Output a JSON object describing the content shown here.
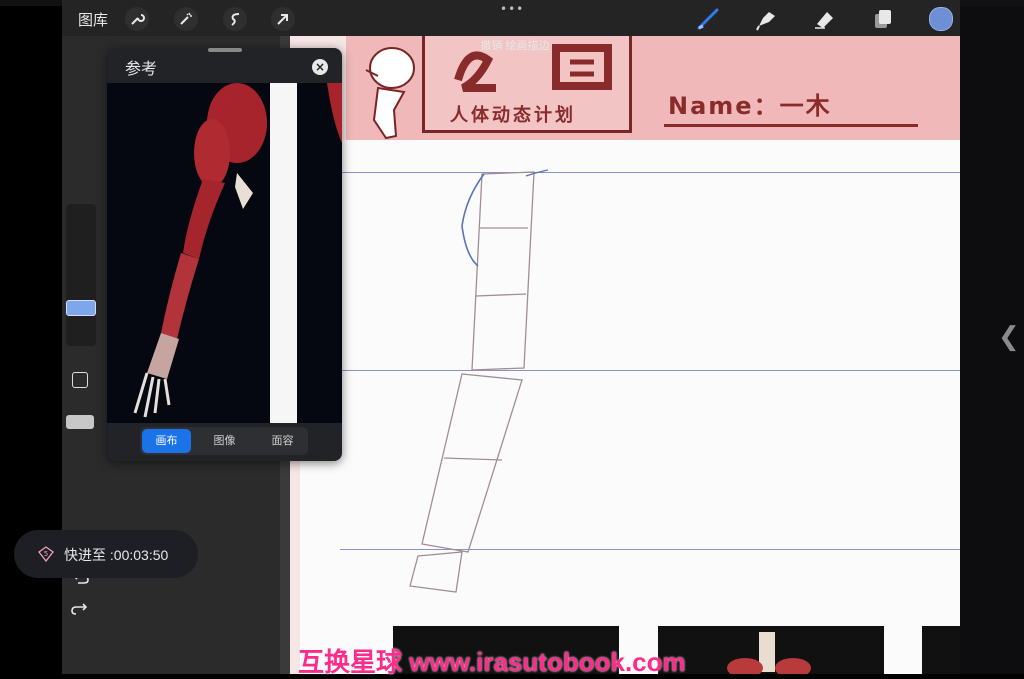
{
  "toolbar": {
    "gallery_label": "图库",
    "left_tools": [
      "wrench-icon",
      "magic-wand-icon",
      "selection-icon",
      "transform-arrow-icon"
    ],
    "right_tools": [
      "brush-icon",
      "smudge-icon",
      "eraser-icon",
      "layers-icon"
    ],
    "color_swatch": "#6d8fd6",
    "accent": "#2f7bf5"
  },
  "toast": {
    "text": "撤销 绘画描边"
  },
  "canvas": {
    "name_text": "Name：一木",
    "plan_text": "人体动态计划",
    "watermark": "互换星球 www.irasutobook.com"
  },
  "reference": {
    "title": "参考",
    "tabs": [
      "画布",
      "图像",
      "面容"
    ],
    "active_tab": "画布"
  },
  "playback": {
    "text": "快进至 :00:03:50",
    "badge": "5"
  },
  "side_chevron": "❮"
}
